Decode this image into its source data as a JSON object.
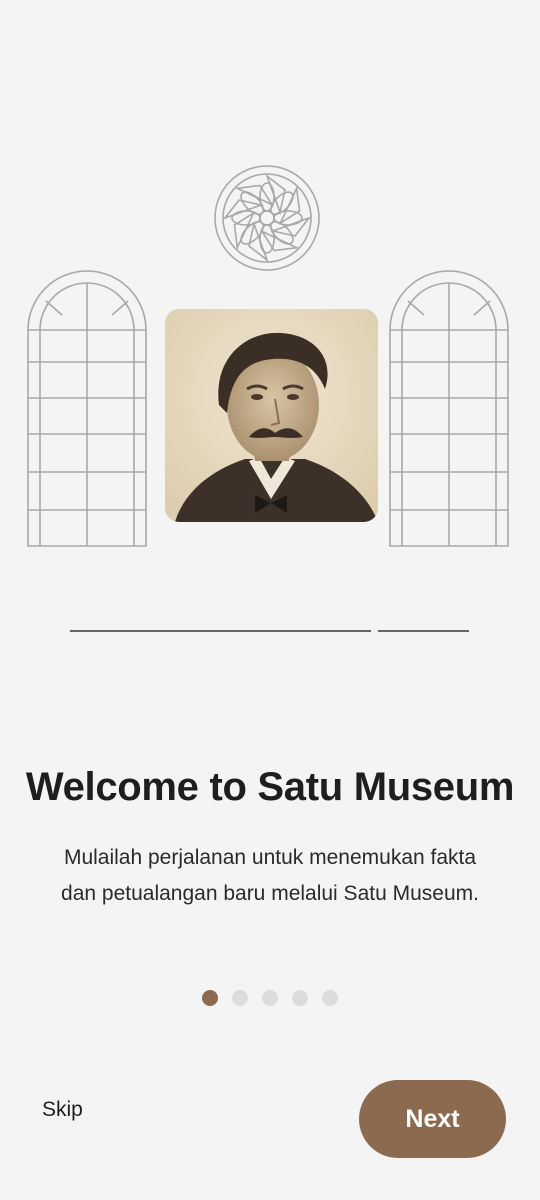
{
  "onboarding": {
    "title": "Welcome to Satu Museum",
    "subtitle": "Mulailah perjalanan untuk menemukan fakta dan petualangan baru melalui Satu Museum.",
    "page_indicator": {
      "total": 5,
      "current": 1
    },
    "skip_label": "Skip",
    "next_label": "Next"
  },
  "colors": {
    "accent": "#8c6a4f",
    "background": "#f4f4f4",
    "dot_inactive": "#dcdcdc",
    "line_art": "#a8a8a8"
  },
  "icons": [
    "rose-window-icon",
    "arched-window-icon"
  ]
}
